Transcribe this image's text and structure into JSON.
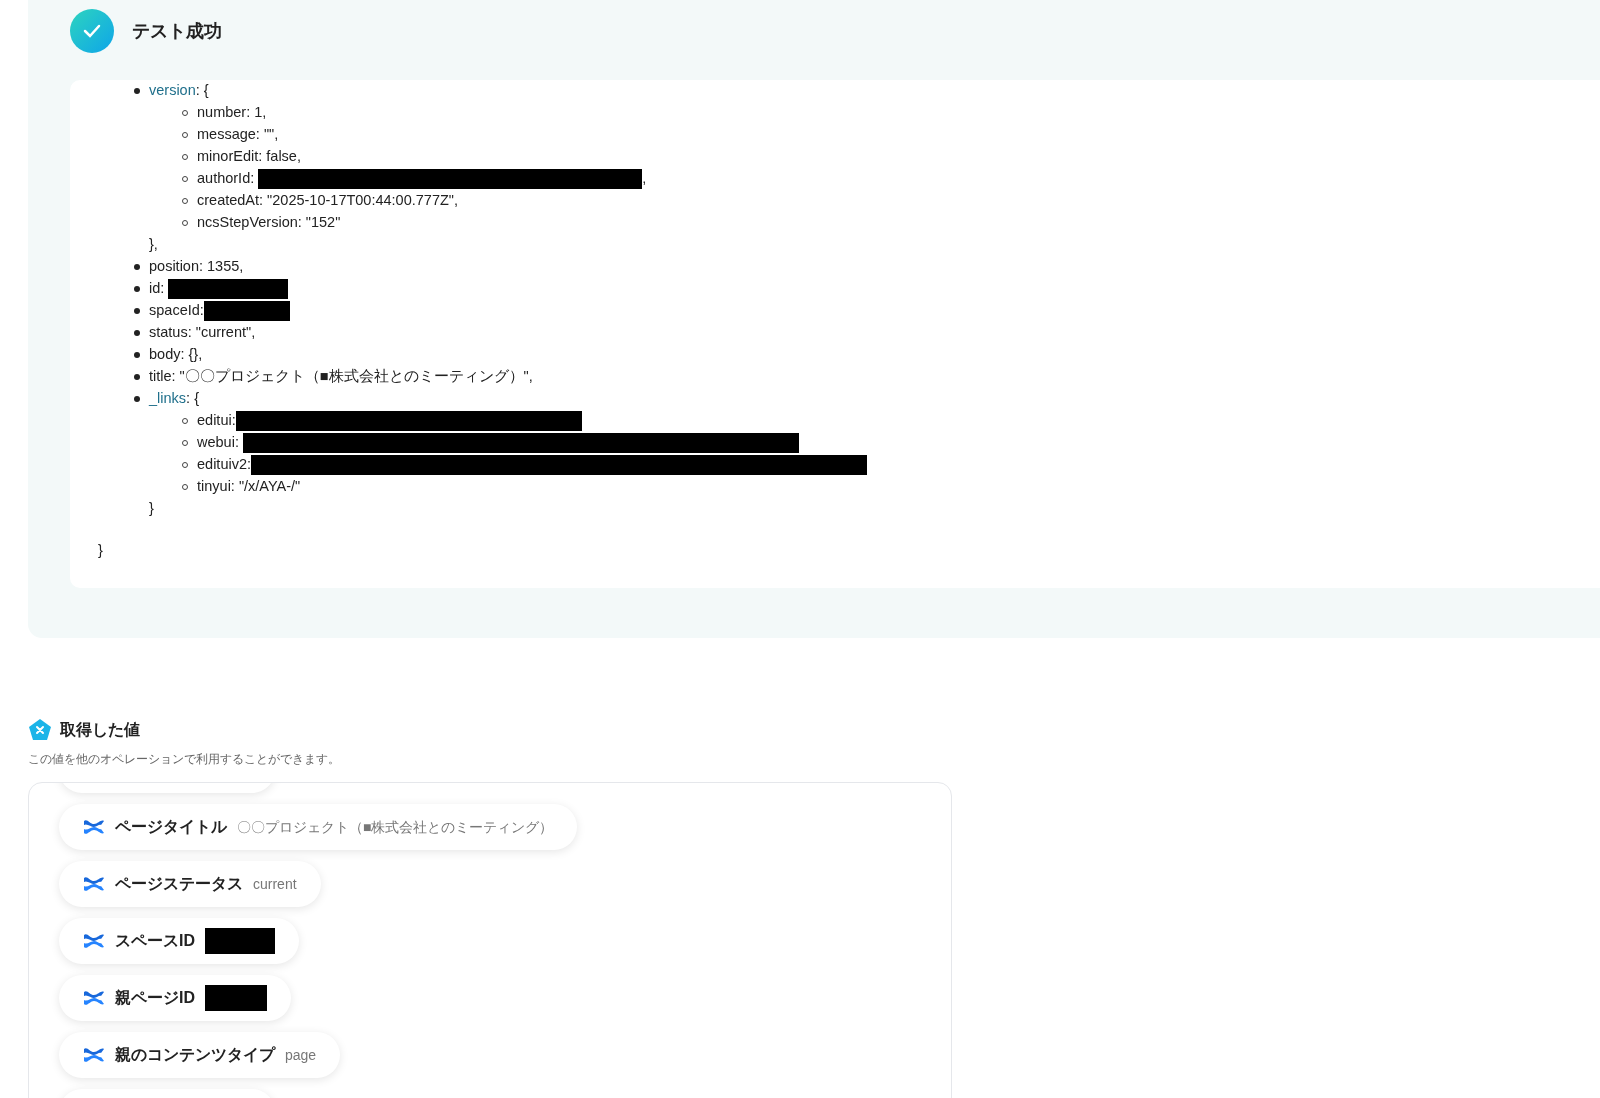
{
  "result": {
    "title": "テスト成功",
    "lines": [
      {
        "key": "version",
        "accent": true,
        "text": ": {",
        "children": [
          {
            "text": "number: 1,"
          },
          {
            "text": "message: \"\","
          },
          {
            "text": "minorEdit: false,"
          },
          {
            "text": "authorId: ",
            "redacted": true,
            "after": ","
          },
          {
            "text": "createdAt: \"2025-10-17T00:44:00.777Z\","
          },
          {
            "text": "ncsStepVersion: \"152\""
          }
        ],
        "closing": "},"
      },
      {
        "text": "position: 1355,"
      },
      {
        "text": "id: ",
        "redacted": true
      },
      {
        "text": "spaceId:",
        "redacted": true
      },
      {
        "text": "status: \"current\","
      },
      {
        "text": "body: {},"
      },
      {
        "text": "title: \"〇〇プロジェクト（■株式会社とのミーティング）\","
      },
      {
        "key": "_links",
        "accent": true,
        "text": ": {",
        "children": [
          {
            "text": "editui:",
            "redacted": true
          },
          {
            "text": "webui: ",
            "redacted": true
          },
          {
            "text": "edituiv2:",
            "redacted": true
          },
          {
            "text": "tinyui: \"/x/AYA-/\""
          }
        ],
        "closing": "}"
      }
    ],
    "end": "}"
  },
  "values": {
    "title": "取得した値",
    "subtitle": "この値を他のオペレーションで利用することができます。",
    "items": [
      {
        "label": "ページタイトル",
        "value": "〇〇プロジェクト（■株式会社とのミーティング）"
      },
      {
        "label": "ページステータス",
        "value": "current"
      },
      {
        "label": "スペースID",
        "redacted": true
      },
      {
        "label": "親ページID",
        "redacted": true
      },
      {
        "label": "親のコンテンツタイプ",
        "value": "page"
      }
    ]
  }
}
